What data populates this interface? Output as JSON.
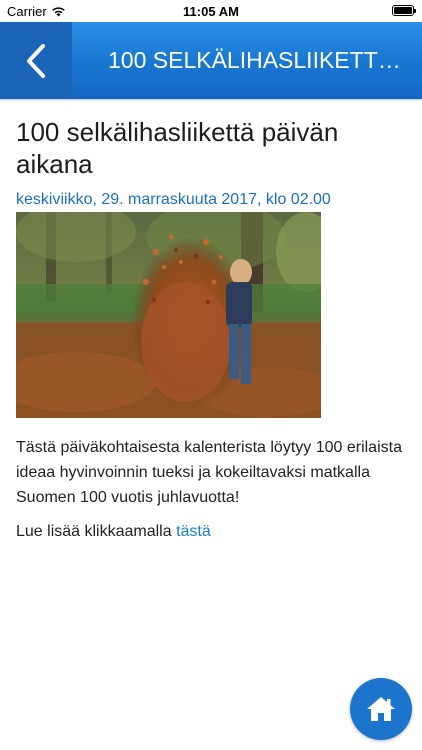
{
  "status_bar": {
    "carrier": "Carrier",
    "time": "11:05 AM"
  },
  "nav": {
    "title": "100 SELKÄLIHASLIIKETTÄ...",
    "back_icon": "chevron-left-icon",
    "background_color": "#1876d1"
  },
  "article": {
    "title": "100 selkälihasliikettä päivän aikana",
    "date": "keskiviikko, 29. marraskuuta 2017, klo 02.00",
    "body": "Tästä päiväkohtaisesta kalenterista löytyy 100 erilaista ideaa hyvinvoinnin tueksi ja kokeiltavaksi matkalla Suomen 100 vuotis juhlavuotta!",
    "read_more_prefix": "Lue lisää klikkaamalla ",
    "read_more_link": "tästä"
  },
  "home_button": {
    "icon": "home-icon",
    "color": "#1c74cc"
  }
}
